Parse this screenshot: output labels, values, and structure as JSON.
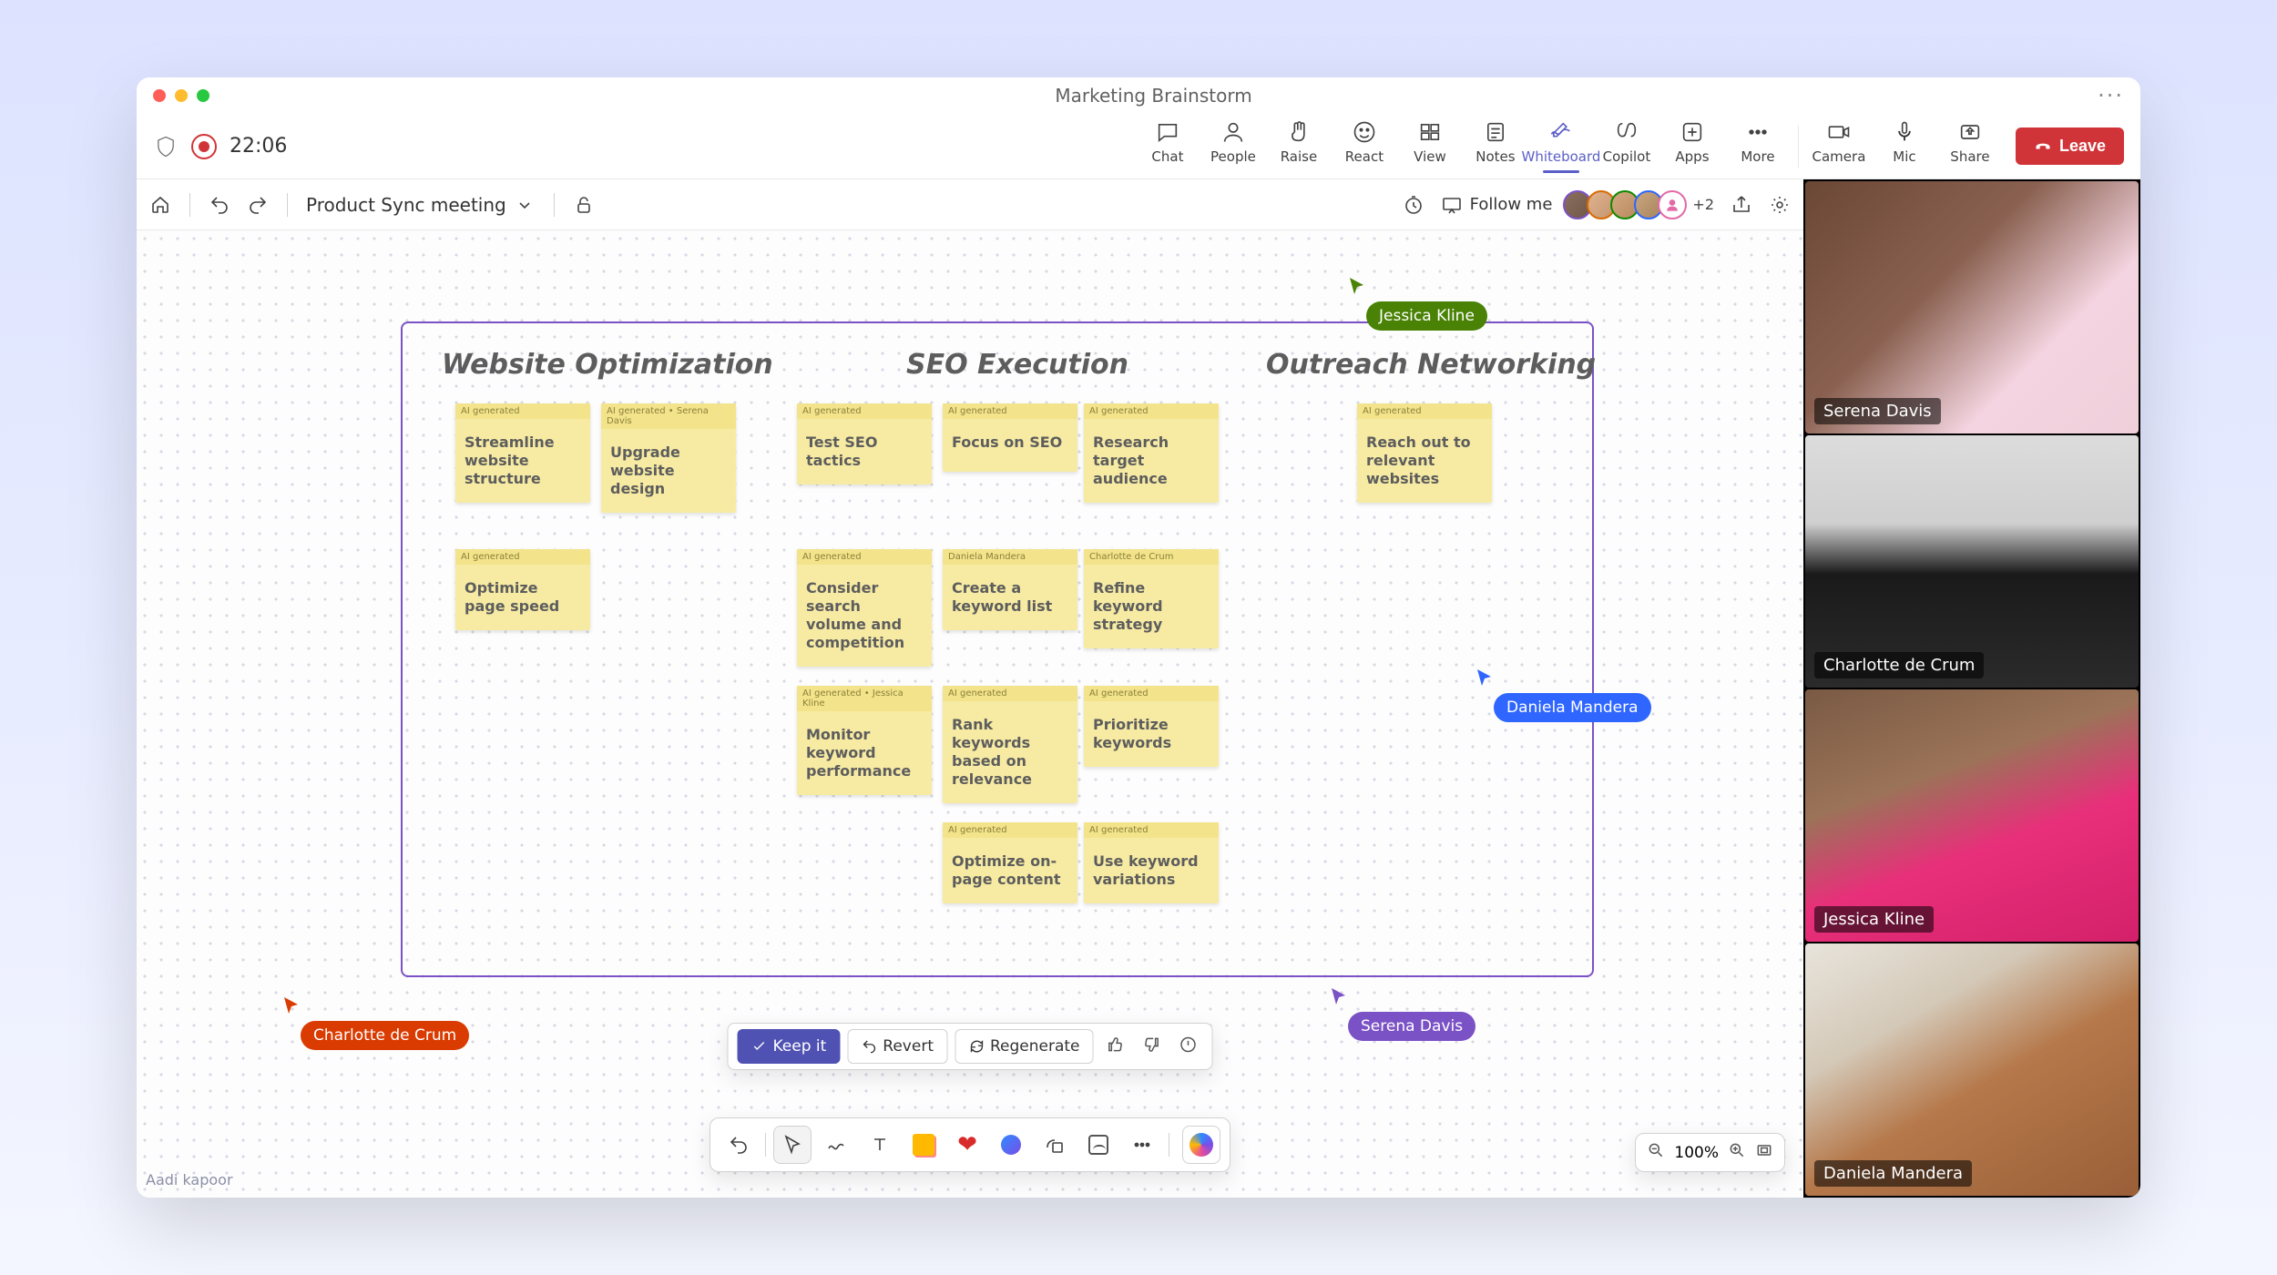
{
  "window": {
    "title": "Marketing Brainstorm",
    "recording_time": "22:06"
  },
  "meeting_actions": {
    "chat": "Chat",
    "people": "People",
    "raise": "Raise",
    "react": "React",
    "view": "View",
    "notes": "Notes",
    "whiteboard": "Whiteboard",
    "copilot": "Copilot",
    "apps": "Apps",
    "more": "More",
    "camera": "Camera",
    "mic": "Mic",
    "share": "Share",
    "leave": "Leave"
  },
  "whiteboard_header": {
    "board_name": "Product Sync meeting",
    "follow_label": "Follow me",
    "extra_avatars": "+2"
  },
  "columns": {
    "c1": "Website Optimization",
    "c2": "SEO Execution",
    "c3": "Outreach Networking"
  },
  "stickies": {
    "ai": "AI generated",
    "ai_serena": "AI generated • Serena Davis",
    "ai_jessica": "AI generated • Jessica Kline",
    "daniela": "Daniela Mandera",
    "charlotte": "Charlotte de Crum",
    "w1": "Streamline website structure",
    "w2": "Upgrade website design",
    "w3": "Optimize page speed",
    "s1": "Test SEO tactics",
    "s2": "Focus on SEO",
    "s3": "Research target audience",
    "s4": "Consider search volume and competition",
    "s5": "Create a keyword list",
    "s6": "Refine keyword strategy",
    "s7": "Monitor keyword performance",
    "s8": "Rank keywords based on relevance",
    "s9": "Prioritize keywords",
    "s10": "Optimize on-page content",
    "s11": "Use keyword variations",
    "o1": "Reach out to relevant websites"
  },
  "cursors": {
    "jessica": "Jessica Kline",
    "daniela": "Daniela Mandera",
    "serena": "Serena Davis",
    "charlotte": "Charlotte de Crum"
  },
  "ai_bar": {
    "keep": "Keep it",
    "revert": "Revert",
    "regenerate": "Regenerate"
  },
  "zoom": {
    "value": "100%"
  },
  "watermark": "Aadi kapoor",
  "participants": {
    "p1": "Serena Davis",
    "p2": "Charlotte de Crum",
    "p3": "Jessica Kline",
    "p4": "Daniela Mandera"
  }
}
